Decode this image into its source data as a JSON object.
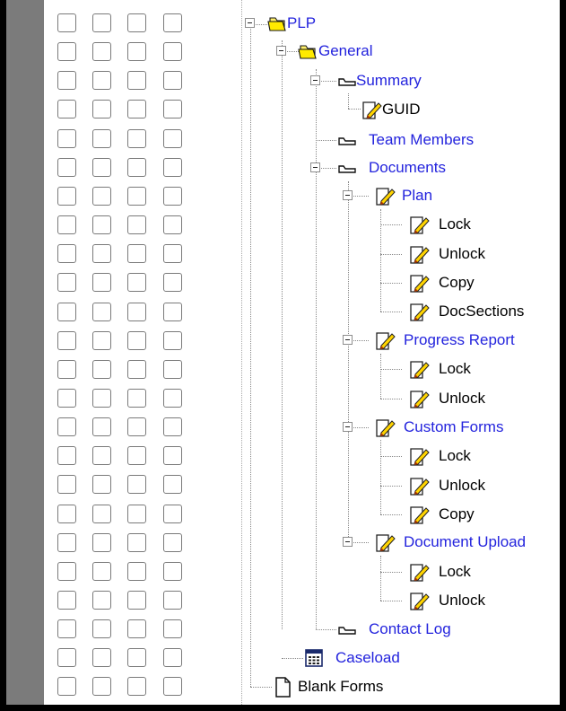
{
  "tree": {
    "root": {
      "label": "PLP",
      "icon": "open-folder-icon"
    },
    "general": {
      "label": "General",
      "icon": "open-folder-icon"
    },
    "summary": {
      "label": "Summary",
      "icon": "tab-icon"
    },
    "summary_guid": {
      "label": "GUID",
      "icon": "edit-document-icon"
    },
    "team_members": {
      "label": "Team Members",
      "icon": "tab-icon"
    },
    "documents": {
      "label": "Documents",
      "icon": "tab-icon"
    },
    "plan": {
      "label": "Plan",
      "icon": "edit-document-icon"
    },
    "plan_lock": {
      "label": "Lock",
      "icon": "edit-document-icon"
    },
    "plan_unlock": {
      "label": "Unlock",
      "icon": "edit-document-icon"
    },
    "plan_copy": {
      "label": "Copy",
      "icon": "edit-document-icon"
    },
    "plan_docsections": {
      "label": "DocSections",
      "icon": "edit-document-icon"
    },
    "progress_report": {
      "label": "Progress Report",
      "icon": "edit-document-icon"
    },
    "progress_lock": {
      "label": "Lock",
      "icon": "edit-document-icon"
    },
    "progress_unlock": {
      "label": "Unlock",
      "icon": "edit-document-icon"
    },
    "custom_forms": {
      "label": "Custom Forms",
      "icon": "edit-document-icon"
    },
    "custom_lock": {
      "label": "Lock",
      "icon": "edit-document-icon"
    },
    "custom_unlock": {
      "label": "Unlock",
      "icon": "edit-document-icon"
    },
    "custom_copy": {
      "label": "Copy",
      "icon": "edit-document-icon"
    },
    "document_upload": {
      "label": "Document Upload",
      "icon": "edit-document-icon"
    },
    "upload_lock": {
      "label": "Lock",
      "icon": "edit-document-icon"
    },
    "upload_unlock": {
      "label": "Unlock",
      "icon": "edit-document-icon"
    },
    "contact_log": {
      "label": "Contact Log",
      "icon": "tab-icon"
    },
    "caseload": {
      "label": "Caseload",
      "icon": "calendar-grid-icon"
    },
    "blank_forms": {
      "label": "Blank Forms",
      "icon": "blank-page-icon"
    }
  },
  "checkbox_grid": {
    "columns": 4,
    "rows": 24
  },
  "colors": {
    "link": "#2323dd",
    "text": "#000000",
    "gutter": "#7b7b7b",
    "frame": "#000000",
    "checkbox_border": "#7a7a7a",
    "tree_line": "#888888",
    "folder_fill": "#ffee00"
  }
}
